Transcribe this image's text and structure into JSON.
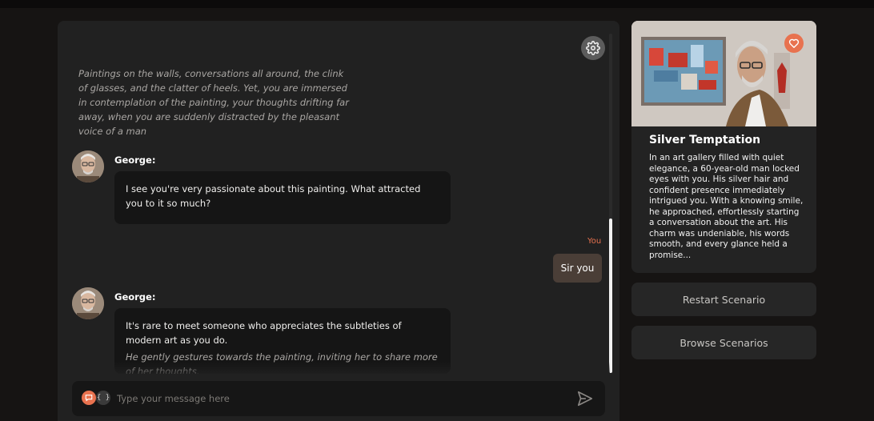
{
  "chat": {
    "narration": "Paintings on the walls, conversations all around, the clink of glasses, and the clatter of heels. Yet, you are immersed in contemplation of the painting, your thoughts drifting far away, when you are suddenly distracted by the pleasant voice of a man",
    "messages": [
      {
        "speaker": "George:",
        "text": "I see you're very passionate about this painting. What attracted you to it so much?"
      },
      {
        "speaker": "You",
        "text": "Sir you"
      },
      {
        "speaker": "George:",
        "text": "It's rare to meet someone who appreciates the subtleties of modern art as you do.",
        "aside": "He gently gestures towards the painting, inviting her to share more of her thoughts."
      }
    ]
  },
  "composer": {
    "placeholder": "Type your message here",
    "brace_label": "{ }"
  },
  "scenario": {
    "title": "Silver Temptation",
    "description": "In an art gallery filled with quiet elegance, a 60-year-old man locked eyes with you. His silver hair and confident presence immediately intrigued you. With a knowing smile, he approached, effortlessly starting a conversation about the art. His charm was undeniable, his words smooth, and every glance held a promise..."
  },
  "actions": {
    "restart": "Restart Scenario",
    "browse": "Browse Scenarios"
  },
  "colors": {
    "accent": "#e8724f",
    "background": "#161413",
    "panel": "#212121"
  },
  "icons": [
    "gear-icon",
    "heart-icon",
    "chat-bubble-icon",
    "send-icon"
  ]
}
